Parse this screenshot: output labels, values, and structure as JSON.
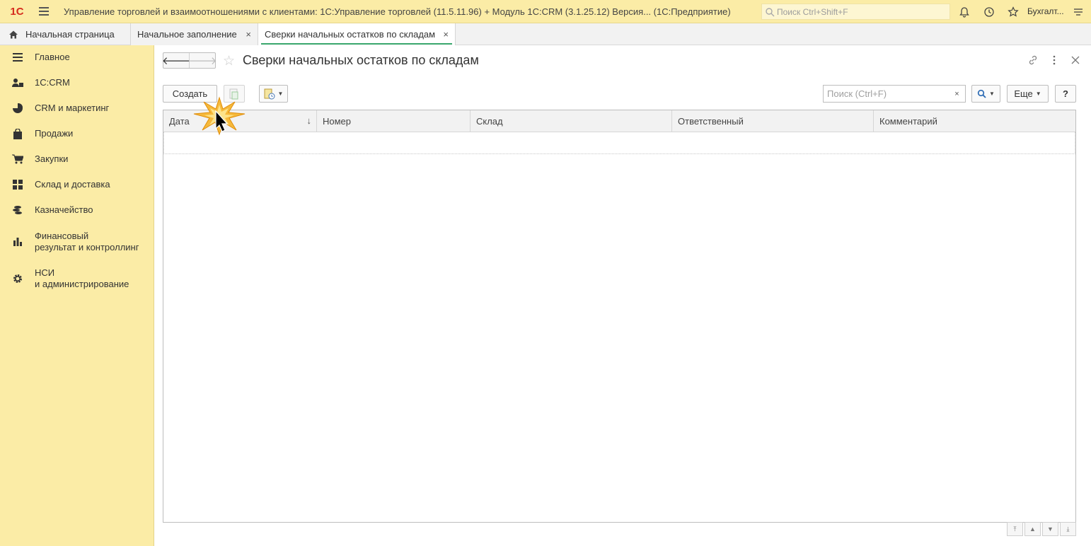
{
  "titlebar": {
    "logo": "1С",
    "app_title": "Управление торговлей и взаимоотношениями с клиентами: 1С:Управление торговлей (11.5.11.96) + Модуль 1С:CRM (3.1.25.12) Версия...  (1С:Предприятие)",
    "search_placeholder": "Поиск Ctrl+Shift+F",
    "user": "Бухгалт..."
  },
  "tabs": [
    {
      "label": "Начальная страница"
    },
    {
      "label": "Начальное заполнение",
      "close": "×"
    },
    {
      "label": "Сверки начальных остатков по складам",
      "close": "×"
    }
  ],
  "sidebar": {
    "items": [
      {
        "label": "Главное",
        "icon": "menu-lines-icon"
      },
      {
        "label": "1С:CRM",
        "icon": "users-icon"
      },
      {
        "label": "CRM и маркетинг",
        "icon": "pie-chart-icon"
      },
      {
        "label": "Продажи",
        "icon": "bag-icon"
      },
      {
        "label": "Закупки",
        "icon": "cart-icon"
      },
      {
        "label": "Склад и доставка",
        "icon": "grid-icon"
      },
      {
        "label": "Казначейство",
        "icon": "coins-icon"
      },
      {
        "label": "Финансовый",
        "label2": "результат и контроллинг",
        "icon": "bar-chart-icon"
      },
      {
        "label": "НСИ",
        "label2": "и администрирование",
        "icon": "gear-icon"
      }
    ]
  },
  "form": {
    "title": "Сверки начальных остатков по складам",
    "create_label": "Создать",
    "search_placeholder": "Поиск (Ctrl+F)",
    "clear": "×",
    "more_label": "Еще",
    "help_label": "?",
    "columns": [
      "Дата",
      "Номер",
      "Склад",
      "Ответственный",
      "Комментарий"
    ],
    "sort_indicator": "↓"
  },
  "colors": {
    "sidebar_bg": "#fbeca6",
    "active_tab_underline": "#3aa76d",
    "logo_red": "#d52b1e"
  }
}
